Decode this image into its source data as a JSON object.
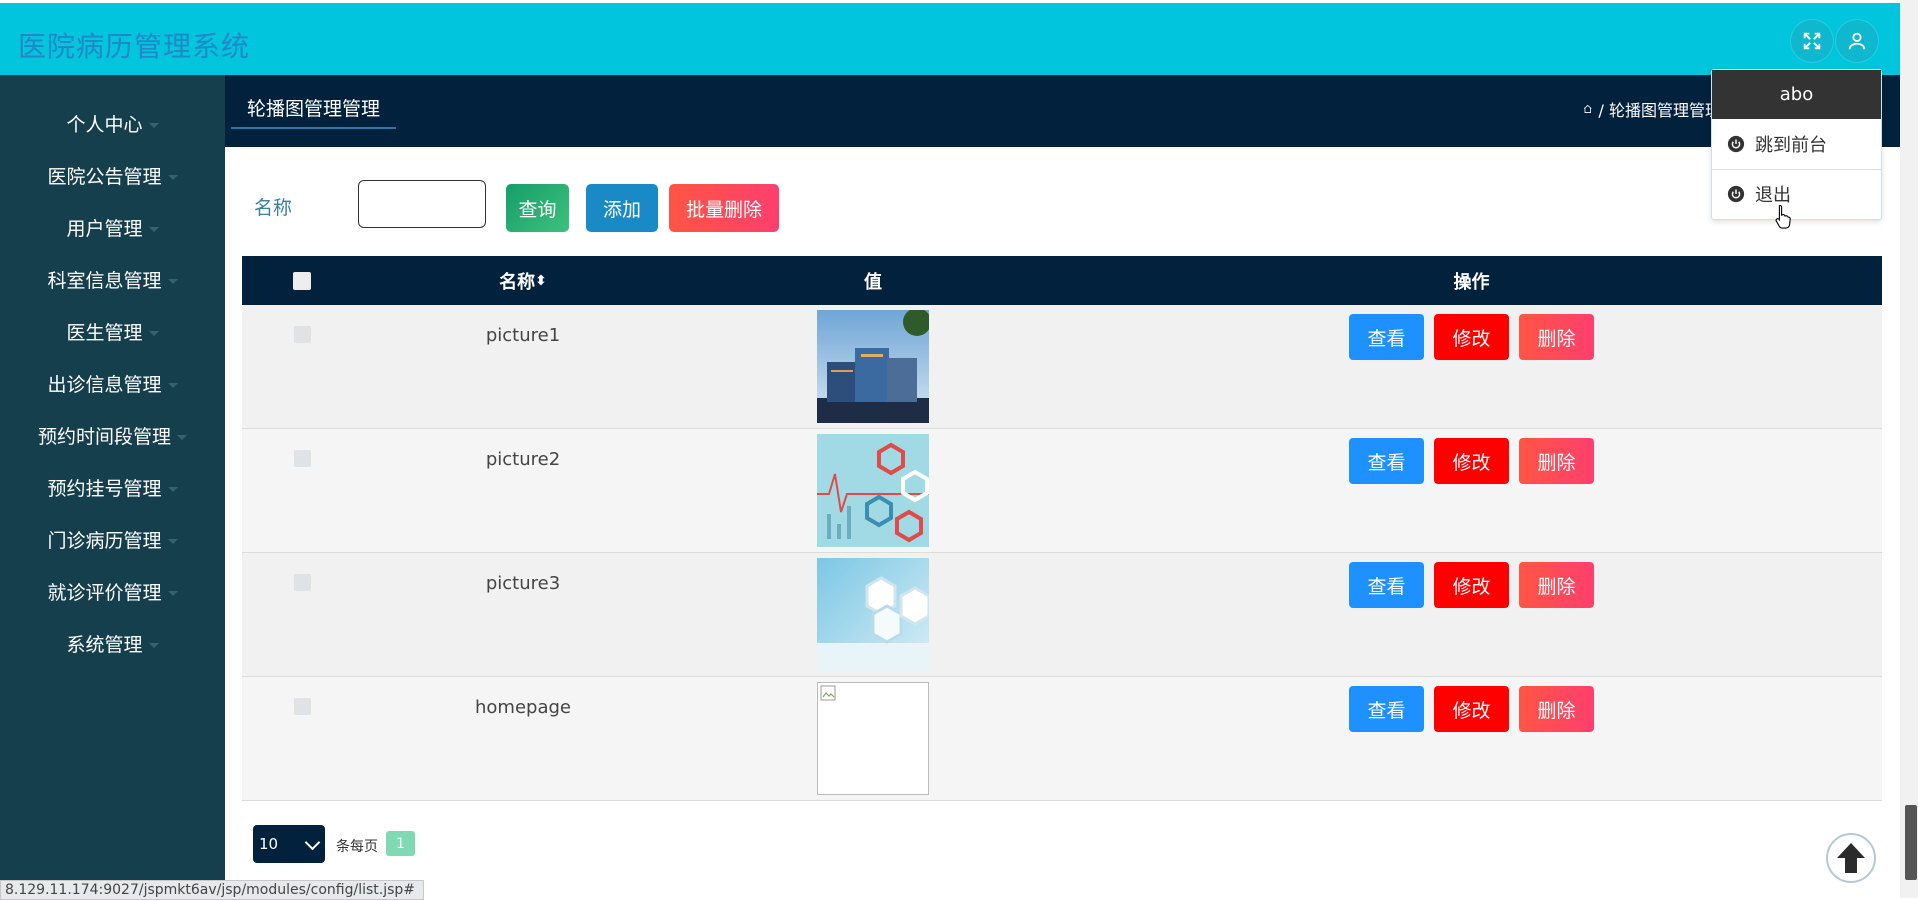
{
  "app": {
    "title": "医院病历管理系统",
    "accent_color": "#00c5dc",
    "sidebar_color": "#163f4e",
    "nav_color": "#02213c"
  },
  "header": {
    "fullscreen_icon": "expand-icon",
    "user_icon": "user-icon"
  },
  "sidebar": {
    "items": [
      {
        "label": "个人中心"
      },
      {
        "label": "医院公告管理"
      },
      {
        "label": "用户管理"
      },
      {
        "label": "科室信息管理"
      },
      {
        "label": "医生管理"
      },
      {
        "label": "出诊信息管理"
      },
      {
        "label": "预约时间段管理"
      },
      {
        "label": "预约挂号管理"
      },
      {
        "label": "门诊病历管理"
      },
      {
        "label": "就诊评价管理"
      },
      {
        "label": "系统管理"
      }
    ]
  },
  "content_nav": {
    "tab_label": "轮播图管理管理",
    "breadcrumb": "/ 轮播图管理管理"
  },
  "search": {
    "label": "名称",
    "value": "",
    "query_label": "查询",
    "add_label": "添加",
    "batch_delete_label": "批量删除"
  },
  "table": {
    "columns": [
      "名称",
      "值",
      "操作"
    ],
    "sort_marker": "⬍",
    "rows": [
      {
        "name": "picture1",
        "image": "hospital-building-image"
      },
      {
        "name": "picture2",
        "image": "medical-hexagon-image"
      },
      {
        "name": "picture3",
        "image": "blue-hexagon-image"
      },
      {
        "name": "homepage",
        "image": "broken-image"
      }
    ],
    "actions": {
      "view": "查看",
      "edit": "修改",
      "delete": "删除"
    }
  },
  "pagination": {
    "page_size": "10",
    "per_page_label": "条每页",
    "current_page": "1"
  },
  "user_menu": {
    "username": "abo",
    "items": [
      {
        "label": "跳到前台",
        "icon": "power-icon"
      },
      {
        "label": "退出",
        "icon": "power-icon"
      }
    ]
  },
  "status_bar": {
    "url": "8.129.11.174:9027/jspmkt6av/jsp/modules/config/list.jsp#"
  }
}
